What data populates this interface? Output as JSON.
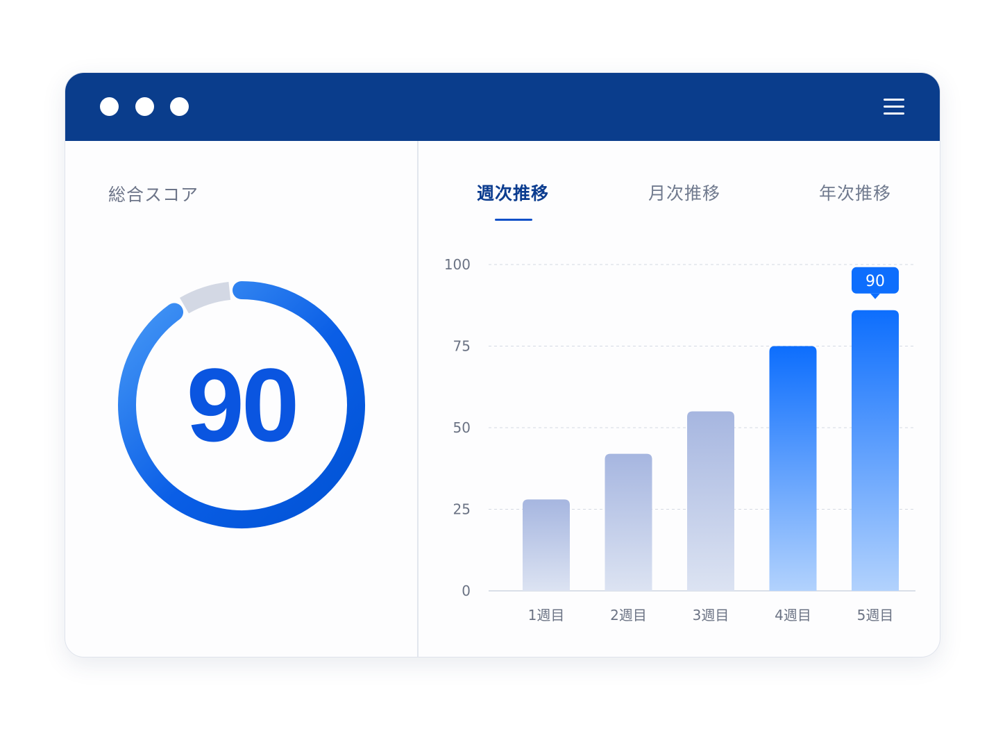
{
  "window": {
    "controls": [
      "window-dot",
      "window-dot",
      "window-dot"
    ],
    "menu_icon": "hamburger-menu-icon"
  },
  "score_panel": {
    "label": "総合スコア",
    "value": "90",
    "progress": 0.9,
    "colors": {
      "progress_start": "#0a5ee6",
      "progress_end": "#4a9cf7",
      "track": "#d3d8e4"
    }
  },
  "tabs": [
    {
      "label": "週次推移",
      "active": true
    },
    {
      "label": "月次推移",
      "active": false
    },
    {
      "label": "年次推移",
      "active": false
    }
  ],
  "chart_data": {
    "type": "bar",
    "categories": [
      "1週目",
      "2週目",
      "3週目",
      "4週目",
      "5週目"
    ],
    "values": [
      28,
      42,
      55,
      75,
      86
    ],
    "ylim": [
      0,
      100
    ],
    "yticks": [
      0,
      25,
      50,
      75,
      100
    ],
    "grid": true,
    "highlighted": [
      false,
      false,
      false,
      true,
      true
    ],
    "annotation": {
      "category_index": 4,
      "text": "90"
    },
    "colors": {
      "muted_top": "#a6b6e0",
      "muted_bottom": "#dce3f2",
      "highlight_top": "#0d6efd",
      "highlight_bottom": "#b2d2fd",
      "annotation_bg": "#0d6efd"
    }
  }
}
